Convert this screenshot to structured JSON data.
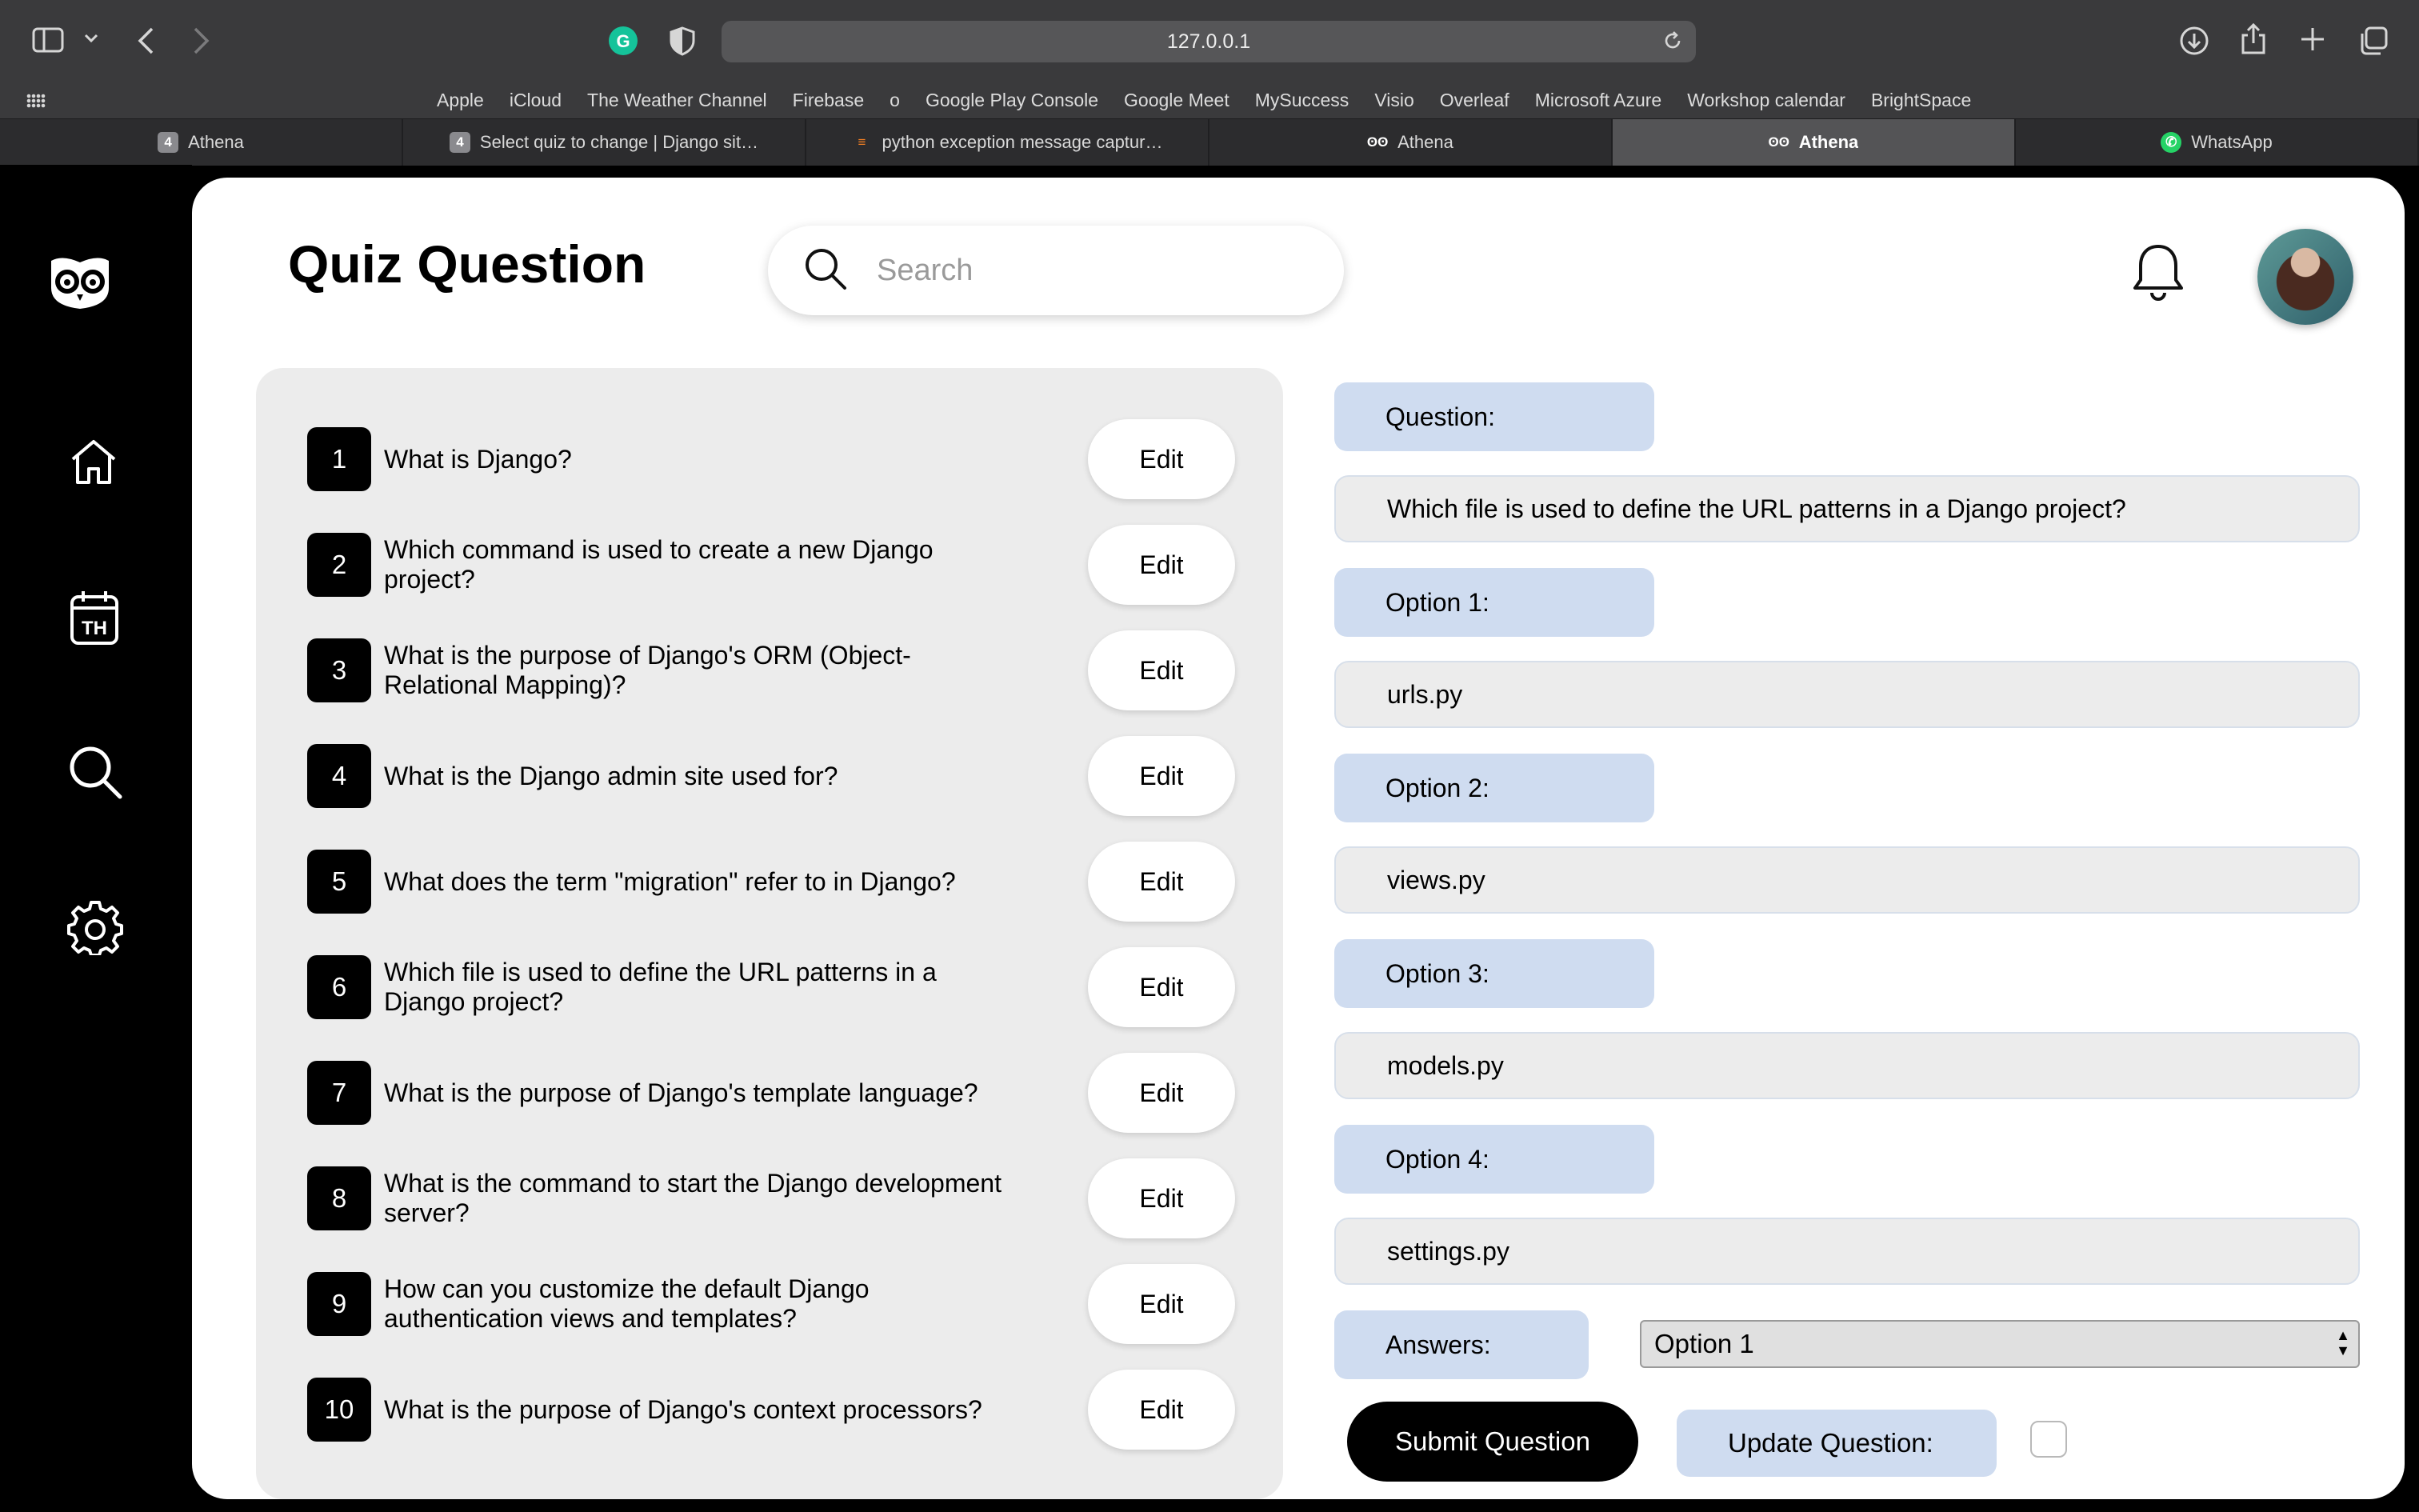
{
  "browser": {
    "url": "127.0.0.1",
    "favorites": [
      "Apple",
      "iCloud",
      "The Weather Channel",
      "Firebase",
      "o",
      "Google Play Console",
      "Google Meet",
      "MySuccess",
      "Visio",
      "Overleaf",
      "Microsoft Azure",
      "Workshop calendar",
      "BrightSpace"
    ],
    "tabs": [
      {
        "label": "Athena",
        "favicon": "4",
        "icon": "django-admin-icon"
      },
      {
        "label": "Select quiz to change | Django sit…",
        "favicon": "4",
        "icon": "django-admin-icon"
      },
      {
        "label": "python exception message captur…",
        "favicon": "≡",
        "icon": "stackoverflow-icon"
      },
      {
        "label": "Athena",
        "favicon": "ʘʘ",
        "icon": "owl-icon"
      },
      {
        "label": "Athena",
        "favicon": "ʘʘ",
        "icon": "owl-icon",
        "active": true
      },
      {
        "label": "WhatsApp",
        "favicon": "✆",
        "icon": "whatsapp-icon"
      }
    ]
  },
  "nav": {
    "items": [
      {
        "icon": "owl-logo-icon"
      },
      {
        "icon": "home-icon"
      },
      {
        "icon": "calendar-icon",
        "text": "TH"
      },
      {
        "icon": "search-icon"
      },
      {
        "icon": "settings-icon"
      }
    ]
  },
  "header": {
    "title": "Quiz Question",
    "search_placeholder": "Search"
  },
  "questions": [
    {
      "num": "1",
      "text": "What is Django?"
    },
    {
      "num": "2",
      "text": "Which command is used to create a new Django project?"
    },
    {
      "num": "3",
      "text": "What is the purpose of Django's ORM (Object-Relational Mapping)?"
    },
    {
      "num": "4",
      "text": "What is the Django admin site used for?"
    },
    {
      "num": "5",
      "text": "What does the term \"migration\" refer to in Django?"
    },
    {
      "num": "6",
      "text": "Which file is used to define the URL patterns in a Django project?"
    },
    {
      "num": "7",
      "text": "What is the purpose of Django's template language?"
    },
    {
      "num": "8",
      "text": "What is the command to start the Django development server?"
    },
    {
      "num": "9",
      "text": "How can you customize the default Django authentication views and templates?"
    },
    {
      "num": "10",
      "text": "What is the purpose of Django's context processors?"
    }
  ],
  "edit_label": "Edit",
  "form": {
    "question_label": "Question:",
    "question_value": "Which file is used to define the URL patterns in a Django project?",
    "option1_label": "Option 1:",
    "option1_value": "urls.py",
    "option2_label": "Option 2:",
    "option2_value": "views.py",
    "option3_label": "Option 3:",
    "option3_value": "models.py",
    "option4_label": "Option 4:",
    "option4_value": "settings.py",
    "answers_label": "Answers:",
    "answers_selected": "Option 1",
    "submit_label": "Submit Question",
    "update_label": "Update Question:",
    "update_checked": false
  },
  "colors": {
    "label_bg": "#cfdcf0",
    "panel_bg": "#ececec",
    "accent": "#000000"
  }
}
